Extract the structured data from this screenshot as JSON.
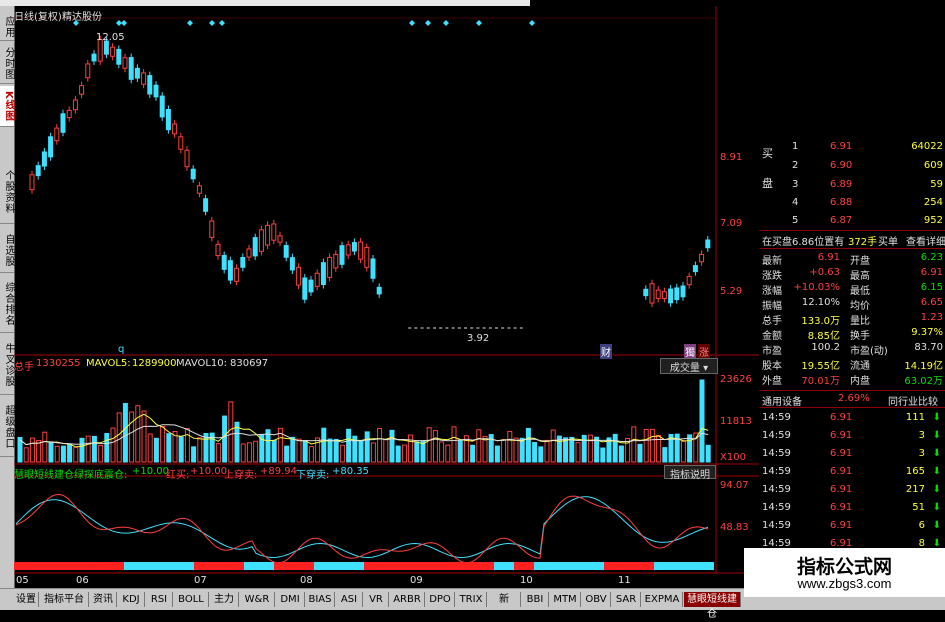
{
  "header": {
    "chart_title": "日线(复权)",
    "stock_name": "精达股份"
  },
  "price_axis": [
    "8.91",
    "7.09",
    "5.29"
  ],
  "annotations": {
    "high_label": "12.05",
    "low_label": "3.92",
    "marker_q": "q",
    "marker_cai": "财",
    "marker_ju": "獨",
    "marker_zhang": "涨"
  },
  "x_axis": [
    "05",
    "06",
    "07",
    "08",
    "09",
    "10",
    "11"
  ],
  "volume": {
    "total_label": "总手",
    "total_value": "1330255",
    "mavol5_label": "MAVOL5:",
    "mavol5_value": "1289900",
    "mavol10_label": "MAVOL10:",
    "mavol10_value": "830697",
    "dropdown_label": "成交量",
    "axis": [
      "23626",
      "11813",
      "X100"
    ]
  },
  "indicator": {
    "name": "慧眼短线建仓",
    "parts": [
      {
        "label": "绿探底震仓:",
        "value": "+10.00",
        "color": "#00e000"
      },
      {
        "label": "红买:",
        "value": "+10.00",
        "color": "#ff4040"
      },
      {
        "label": "上穿卖:",
        "value": "+89.94",
        "color": "#ff4040"
      },
      {
        "label": "下穿卖:",
        "value": "+80.35",
        "color": "#40e0ff"
      }
    ],
    "help_button": "指标说明",
    "axis": [
      "94.07",
      "48.83"
    ]
  },
  "left_tabs": [
    "应用",
    "分时图",
    "K线图",
    "个股资料",
    "自选股",
    "综合排名",
    "牛叉诊股",
    "超级盘口"
  ],
  "bottom_tabs": [
    "设置",
    "指标平台",
    "资讯",
    "KDJ",
    "RSI",
    "BOLL",
    "主力",
    "W&R",
    "DMI",
    "BIAS",
    "ASI",
    "VR",
    "ARBR",
    "DPO",
    "TRIX",
    "新DMA",
    "BBI",
    "MTM",
    "OBV",
    "SAR",
    "EXPMA",
    "慧眼短线建仓"
  ],
  "quote": {
    "buy_label": "买盘",
    "bids": [
      {
        "level": "1",
        "price": "6.91",
        "vol": "64022"
      },
      {
        "level": "2",
        "price": "6.90",
        "vol": "609"
      },
      {
        "level": "3",
        "price": "6.89",
        "vol": "59"
      },
      {
        "level": "4",
        "price": "6.88",
        "vol": "254"
      },
      {
        "level": "5",
        "price": "6.87",
        "vol": "952"
      }
    ],
    "position_text": "在买盘6.86位置有",
    "position_vol": "372手",
    "buy_one": "买单",
    "detail": "查看详细",
    "stats": [
      {
        "l1": "最新",
        "v1": "6.91",
        "l2": "开盘",
        "v2": "6.23",
        "c1": "#ff4040",
        "c2": "#00e000"
      },
      {
        "l1": "涨跌",
        "v1": "+0.63",
        "l2": "最高",
        "v2": "6.91",
        "c1": "#ff4040",
        "c2": "#ff4040"
      },
      {
        "l1": "涨幅",
        "v1": "+10.03%",
        "l2": "最低",
        "v2": "6.15",
        "c1": "#ff4040",
        "c2": "#00e000"
      },
      {
        "l1": "振幅",
        "v1": "12.10%",
        "l2": "均价",
        "v2": "6.65",
        "c1": "#e0e0e0",
        "c2": "#ff4040"
      },
      {
        "l1": "总手",
        "v1": "133.0万",
        "l2": "量比",
        "v2": "1.23",
        "c1": "#ffff40",
        "c2": "#ff4040"
      },
      {
        "l1": "金额",
        "v1": "8.85亿",
        "l2": "换手",
        "v2": "9.37%",
        "c1": "#ffff40",
        "c2": "#ffff40"
      },
      {
        "l1": "市盈",
        "v1": "100.2",
        "l2": "市盈(动)",
        "v2": "83.70",
        "c1": "#e0e0e0",
        "c2": "#e0e0e0"
      },
      {
        "l1": "股本",
        "v1": "19.55亿",
        "l2": "流通",
        "v2": "14.19亿",
        "c1": "#ffff40",
        "c2": "#ffff40"
      },
      {
        "l1": "外盘",
        "v1": "70.01万",
        "l2": "内盘",
        "v2": "63.02万",
        "c1": "#ff4040",
        "c2": "#00e000"
      }
    ],
    "sector": "通用设备",
    "sector_pct": "2.69%",
    "compare": "同行业比较",
    "ticks": [
      {
        "time": "14:59",
        "price": "6.91",
        "vol": "111"
      },
      {
        "time": "14:59",
        "price": "6.91",
        "vol": "3"
      },
      {
        "time": "14:59",
        "price": "6.91",
        "vol": "3"
      },
      {
        "time": "14:59",
        "price": "6.91",
        "vol": "165"
      },
      {
        "time": "14:59",
        "price": "6.91",
        "vol": "217"
      },
      {
        "time": "14:59",
        "price": "6.91",
        "vol": "51"
      },
      {
        "time": "14:59",
        "price": "6.91",
        "vol": "6"
      },
      {
        "time": "14:59",
        "price": "6.91",
        "vol": "8"
      }
    ]
  },
  "watermark": {
    "title": "指标公式网",
    "url": "www.zbgs3.com"
  }
}
